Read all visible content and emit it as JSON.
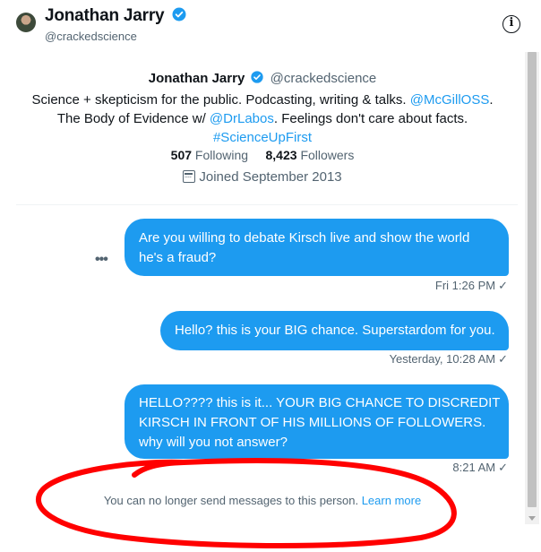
{
  "header": {
    "name": "Jonathan Jarry",
    "handle": "@crackedscience",
    "info_icon": "info-icon"
  },
  "profile": {
    "name": "Jonathan Jarry",
    "handle": "@crackedscience",
    "bio_line1_text": "Science + skepticism for the public. Podcasting, writing & talks.",
    "bio_line1_link": "@McGillOSS",
    "bio_line1_end": ".",
    "bio_line2_text": "The Body of Evidence w/",
    "bio_line2_link": "@DrLabos",
    "bio_line2_end": ". Feelings don't care about facts.",
    "bio_hashtag": "#ScienceUpFirst",
    "following_count": "507",
    "following_label": "Following",
    "followers_count": "8,423",
    "followers_label": "Followers",
    "joined": "Joined September 2013"
  },
  "messages": [
    {
      "text": "Are you willing to debate Kirsch live and show the world he's a fraud?",
      "time": "Fri 1:26 PM"
    },
    {
      "text": "Hello? this is your BIG chance. Superstardom for you.",
      "time": "Yesterday, 10:28 AM"
    },
    {
      "text": "HELLO???? this is it... YOUR BIG CHANCE TO DISCREDIT KIRSCH IN FRONT OF HIS MILLIONS OF FOLLOWERS. why will you not answer?",
      "time": "8:21 AM"
    }
  ],
  "more_menu": "•••",
  "check_mark": "✓",
  "notice": {
    "text": "You can no longer send messages to this person.",
    "link": "Learn more"
  },
  "colors": {
    "accent": "#1d9bf0",
    "annotation": "#ff0000",
    "muted": "#536471"
  }
}
